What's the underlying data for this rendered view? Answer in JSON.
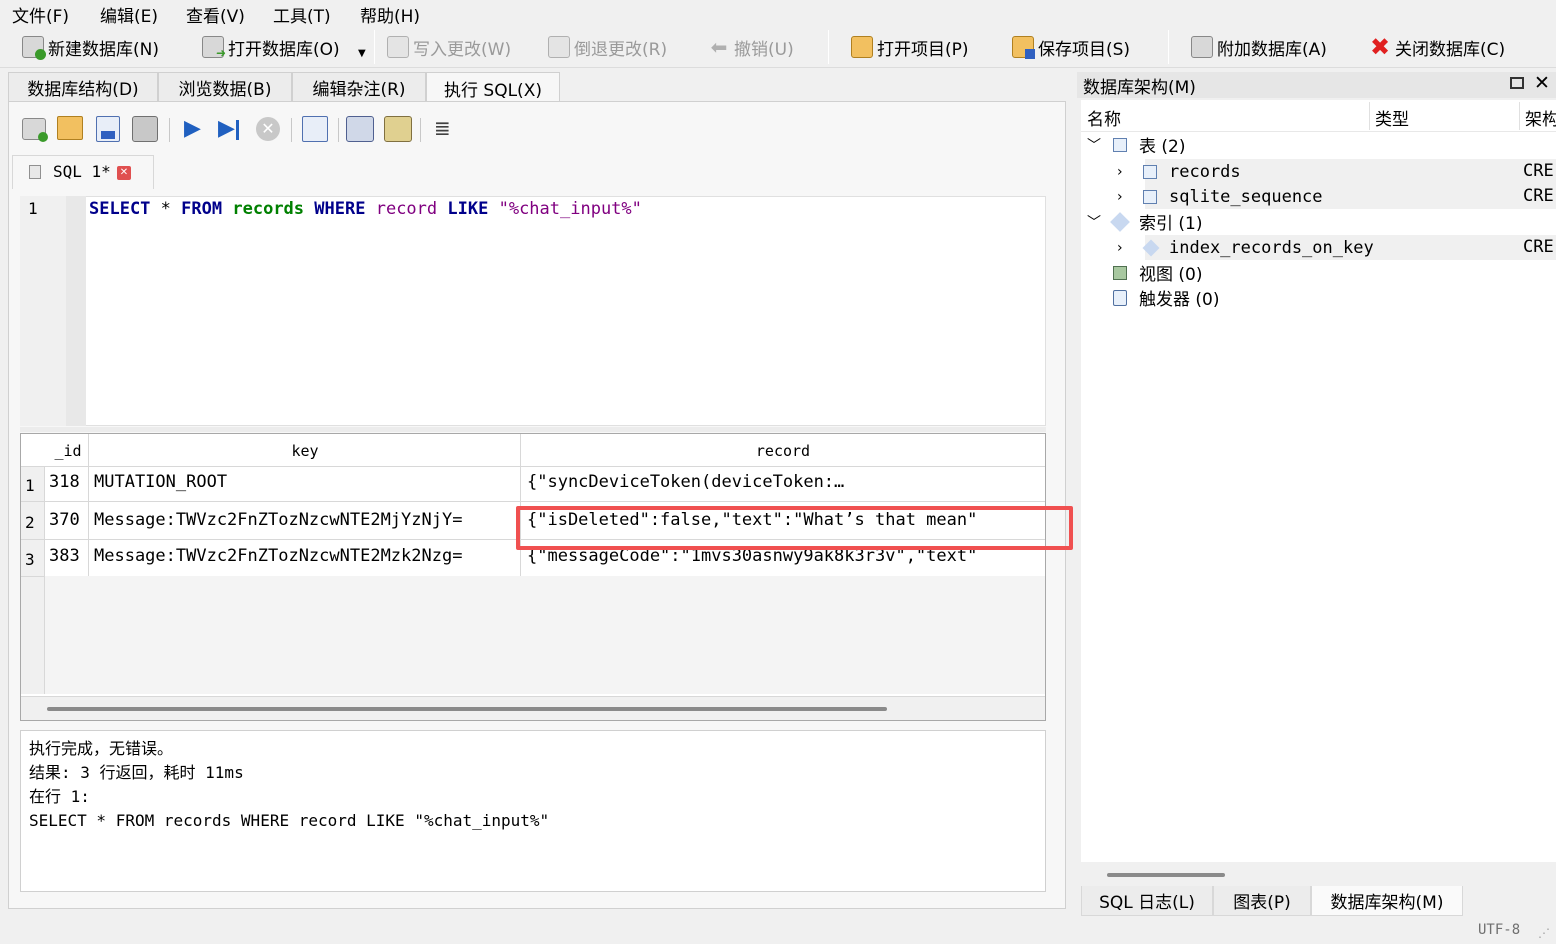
{
  "menu": {
    "file": "文件(F)",
    "edit": "编辑(E)",
    "view": "查看(V)",
    "tools": "工具(T)",
    "help": "帮助(H)"
  },
  "toolbar": {
    "new_db": "新建数据库(N)",
    "open_db": "打开数据库(O)",
    "write_changes": "写入更改(W)",
    "revert_changes": "倒退更改(R)",
    "undo": "撤销(U)",
    "open_project": "打开项目(P)",
    "save_project": "保存项目(S)",
    "attach_db": "附加数据库(A)",
    "close_db": "关闭数据库(C)"
  },
  "tabs": {
    "structure": "数据库结构(D)",
    "browse": "浏览数据(B)",
    "edit_pragmas": "编辑杂注(R)",
    "execute_sql": "执行 SQL(X)"
  },
  "editor": {
    "tab_label": "SQL 1*",
    "line_number": "1",
    "sql": {
      "select": "SELECT",
      "star": "*",
      "from": "FROM",
      "table": "records",
      "where": "WHERE",
      "column": "record",
      "like": "LIKE",
      "pattern": "\"%chat_input%\""
    }
  },
  "results": {
    "columns": [
      "_id",
      "key",
      "record"
    ],
    "rows": [
      {
        "num": "1",
        "id": "318",
        "key": "MUTATION_ROOT",
        "record": "{\"syncDeviceToken(deviceToken:…"
      },
      {
        "num": "2",
        "id": "370",
        "key": "Message:TWVzc2FnZTozNzcwNTE2MjYzNjY=",
        "record": "{\"isDeleted\":false,\"text\":\"What’s that mean\""
      },
      {
        "num": "3",
        "id": "383",
        "key": "Message:TWVzc2FnZTozNzcwNTE2Mzk2Nzg=",
        "record": "{\"messageCode\":\"1mvs30asnwy9ak8k3r3v\",\"text\""
      }
    ]
  },
  "messages": {
    "line1": "执行完成，无错误。",
    "line2": "结果: 3 行返回，耗时 11ms",
    "line3": "在行 1:",
    "line4": "SELECT * FROM records WHERE record LIKE \"%chat_input%\""
  },
  "schema": {
    "title": "数据库架构(M)",
    "col_name": "名称",
    "col_type": "类型",
    "col_schema": "架构",
    "tables_label": "表 (2)",
    "tables": [
      {
        "name": "records",
        "schema": "CRE"
      },
      {
        "name": "sqlite_sequence",
        "schema": "CRE"
      }
    ],
    "indexes_label": "索引 (1)",
    "indexes": [
      {
        "name": "index_records_on_key",
        "schema": "CRE"
      }
    ],
    "views_label": "视图 (0)",
    "triggers_label": "触发器 (0)"
  },
  "bottom_tabs": {
    "sql_log": "SQL 日志(L)",
    "plot": "图表(P)",
    "db_schema": "数据库架构(M)"
  },
  "status": {
    "encoding": "UTF-8"
  },
  "colors": {
    "keyword": "#00008b",
    "table": "#008000",
    "column": "#800080",
    "string": "#800080",
    "highlight_border": "#f05050",
    "close_red": "#e02020"
  }
}
